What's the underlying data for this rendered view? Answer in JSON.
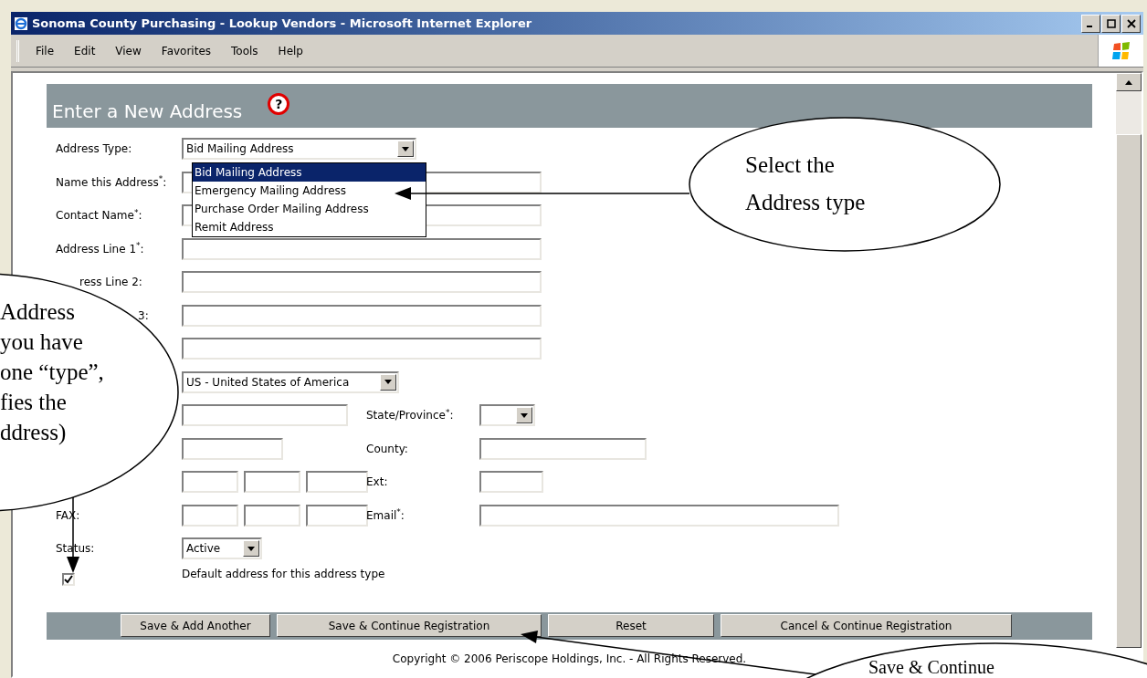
{
  "window": {
    "title": "Sonoma County Purchasing - Lookup Vendors - Microsoft Internet Explorer"
  },
  "menu": [
    {
      "label": "File"
    },
    {
      "label": "Edit"
    },
    {
      "label": "View"
    },
    {
      "label": "Favorites"
    },
    {
      "label": "Tools"
    },
    {
      "label": "Help"
    }
  ],
  "form": {
    "heading": "Enter a New Address",
    "help_icon": "?",
    "rows": [
      {
        "kind": "select",
        "label": "Address Type:",
        "value": "Bid Mailing Address"
      },
      {
        "kind": "text",
        "label": "Name this Address$^{*}$:"
      },
      {
        "kind": "text",
        "label": "Contact Name$^{*}$:"
      },
      {
        "kind": "text",
        "label": "Address Line 1$^{*}$:"
      },
      {
        "kind": "text",
        "label": "ress Line 2:"
      },
      {
        "kind": "text",
        "label": "3:"
      },
      {
        "kind": "text"
      },
      {
        "kind": "select",
        "value": "US - United States of America"
      },
      {
        "kind": "city_state",
        "right_label": "State/Province$^{*}$:"
      },
      {
        "kind": "zip_county",
        "right_label": "County:"
      },
      {
        "kind": "phone_ext",
        "right_label": "Ext:"
      },
      {
        "kind": "fax_email",
        "label": "FAX:",
        "right_label": "Email$^{*}$:"
      },
      {
        "kind": "select",
        "label": "Status:",
        "value": "Active"
      }
    ],
    "default_checkbox": {
      "checked": true,
      "label": "Default address for this address type"
    },
    "dropdown_options": [
      {
        "label": "Bid Mailing Address",
        "selected": true
      },
      {
        "label": "Emergency Mailing Address",
        "selected": false
      },
      {
        "label": "Purchase Order Mailing Address",
        "selected": false
      },
      {
        "label": "Remit Address",
        "selected": false
      }
    ],
    "buttons": [
      {
        "label": "Save & Add Another"
      },
      {
        "label": "Save & Continue Registration"
      },
      {
        "label": "Reset"
      },
      {
        "label": "Cancel & Continue Registration"
      }
    ],
    "copyright": "Copyright © 2006 Periscope Holdings, Inc. - All Rights Reserved."
  },
  "callouts": {
    "address_type": {
      "lines": [
        "Select the",
        "Address type"
      ]
    },
    "default_address": {
      "lines": [
        "Address",
        "you have",
        "one “type”,",
        "fies the",
        "ddress)"
      ]
    },
    "save_continue": {
      "lines": [
        "Save & Continue"
      ]
    }
  }
}
